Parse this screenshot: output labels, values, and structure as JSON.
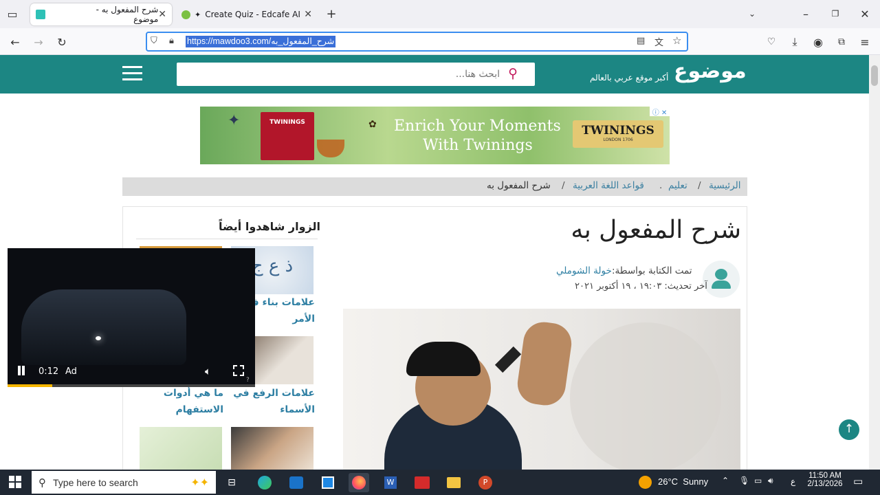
{
  "browser": {
    "tabs": [
      {
        "title": "شرح المفعول به - موضوع",
        "active": true
      },
      {
        "title": "Create Quiz - Edcafe AI",
        "active": false
      }
    ],
    "url": "https://mawdoo3.com/شرح_المفعول_به"
  },
  "site": {
    "logo": "موضوع",
    "tagline": "أكبر موقع عربي بالعالم",
    "search_placeholder": "ابحث هنا..."
  },
  "ad": {
    "headline1": "Enrich Your Moments",
    "headline2": "With Twinings",
    "brand": "TWININGS",
    "brand_sub": "LONDON 1706",
    "box_text": "TWININGS"
  },
  "breadcrumb": [
    "الرئيسية",
    "تعليم",
    "قواعد اللغة العربية",
    "شرح المفعول به"
  ],
  "article": {
    "title": "شرح المفعول به",
    "author_label": "تمت الكتابة بواسطة:",
    "author": "خولة الشوملي",
    "updated": "آخر تحديث: ١٩:٠٣ ، ١٩ أكتوبر ٢٠٢١"
  },
  "related": {
    "heading": "الزوار شاهدوا أيضاً",
    "items": [
      {
        "title_l1": "علامات بناء ف",
        "title_l2": "الأمر"
      },
      {
        "title_l1": "علامات الرفع في",
        "title_l2": "الأسماء"
      },
      {
        "title_l1": "ما هي أدوات",
        "title_l2": "الاستفهام"
      }
    ]
  },
  "video": {
    "time": "0:12",
    "ad_label": "Ad",
    "progress": 0.18
  },
  "taskbar": {
    "search_placeholder": "Type here to search",
    "weather": "26°C  Sunny",
    "lang": "ع",
    "time": "11:50 AM",
    "date": "2/13/2026"
  },
  "colors": {
    "brand": "#1c8683",
    "link": "#2e7fa3",
    "accent": "#f5b500"
  }
}
